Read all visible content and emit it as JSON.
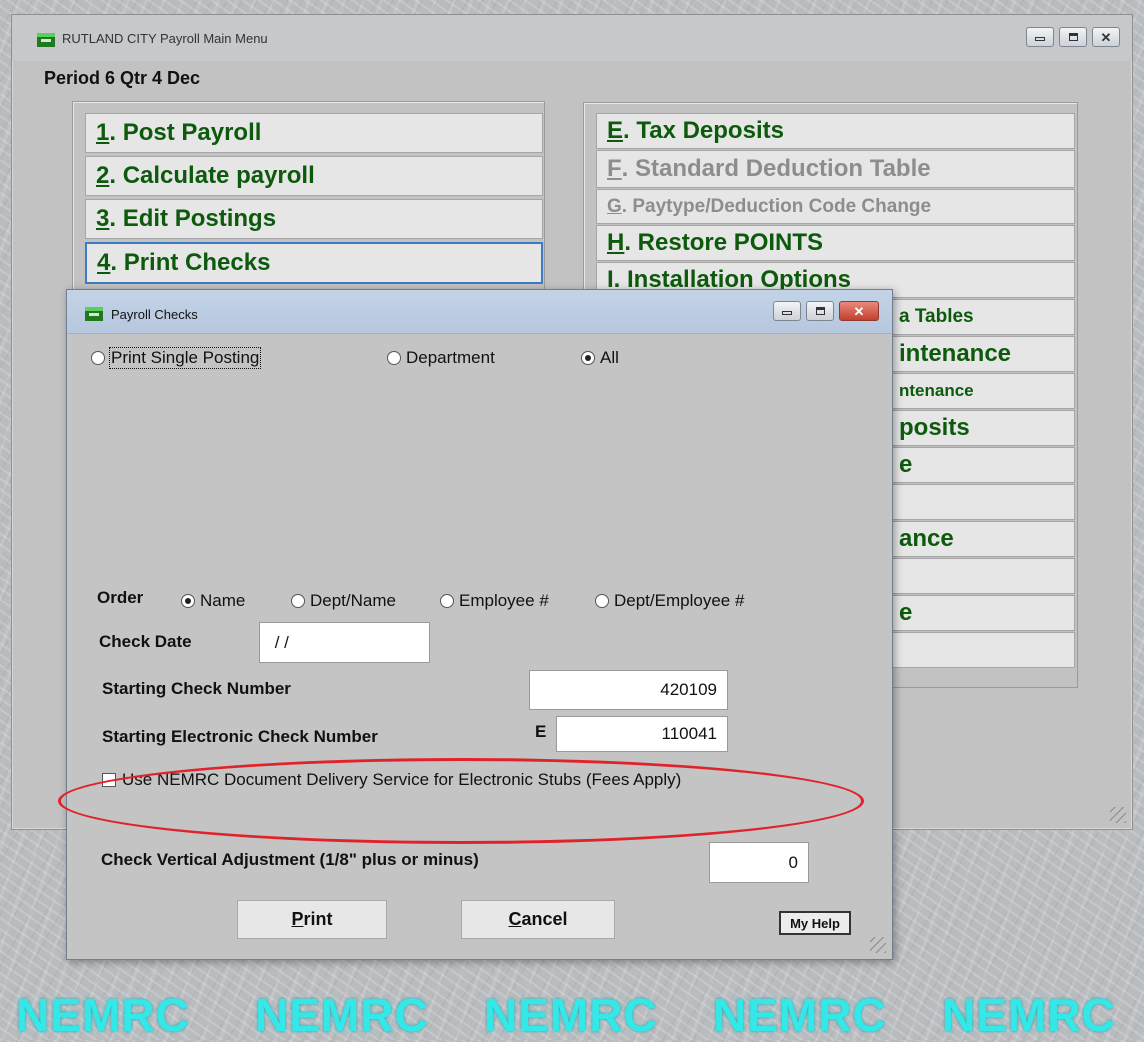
{
  "main_window": {
    "title": "RUTLAND CITY Payroll  Main Menu",
    "period": "Period 6 Qtr 4 Dec",
    "left_menu": [
      {
        "key": "1",
        "label": ". Post Payroll"
      },
      {
        "key": "2",
        "label": ". Calculate payroll"
      },
      {
        "key": "3",
        "label": ". Edit Postings"
      },
      {
        "key": "4",
        "label": ". Print Checks"
      }
    ],
    "right_menu": [
      {
        "key": "E",
        "label": ". Tax Deposits"
      },
      {
        "key": "F",
        "label": ". Standard Deduction Table"
      },
      {
        "key": "G",
        "label": ". Paytype/Deduction Code Change"
      },
      {
        "key": "H",
        "label": ".  Restore POINTS"
      },
      {
        "key": "I",
        "label": ". Installation Options"
      },
      {
        "key": "",
        "label": "a Tables"
      },
      {
        "key": "",
        "label": "intenance"
      },
      {
        "key": "",
        "label": "ntenance"
      },
      {
        "key": "",
        "label": "posits"
      },
      {
        "key": "",
        "label": "e"
      },
      {
        "key": "",
        "label": ""
      },
      {
        "key": "",
        "label": "ance"
      },
      {
        "key": "",
        "label": ""
      },
      {
        "key": "",
        "label": "e"
      },
      {
        "key": "",
        "label": ""
      }
    ]
  },
  "dialog": {
    "title": "Payroll Checks",
    "scope_options": [
      "Print Single Posting",
      "Department",
      "All"
    ],
    "scope_selected": "All",
    "order_label": "Order",
    "order_options": [
      "Name",
      "Dept/Name",
      "Employee #",
      "Dept/Employee #"
    ],
    "order_selected": "Name",
    "check_date_label": "Check Date",
    "check_date_value": " / /",
    "starting_check_label": "Starting Check Number",
    "starting_check_value": "420109",
    "starting_electronic_label": "Starting Electronic Check Number",
    "electronic_prefix": "E",
    "starting_electronic_value": "110041",
    "delivery_checkbox_label": "Use NEMRC Document Delivery Service for Electronic Stubs (Fees Apply)",
    "delivery_checked": false,
    "vertical_adjust_label": "Check Vertical Adjustment (1/8\" plus or minus)",
    "vertical_adjust_value": "0",
    "print_key": "P",
    "print_rest": "rint",
    "cancel_key": "C",
    "cancel_rest": "ancel",
    "help_label": "My Help"
  },
  "footer": {
    "logos": [
      "NEMRC",
      "NEMRC",
      "NEMRC",
      "NEMRC",
      "NEMRC"
    ],
    "logo_color": "#35e8e8"
  },
  "colors": {
    "menu_text": "#0d5a0d",
    "menu_disabled": "#8d8d8d",
    "selected_border": "#3d7cc4",
    "highlight": "#e0232a"
  }
}
